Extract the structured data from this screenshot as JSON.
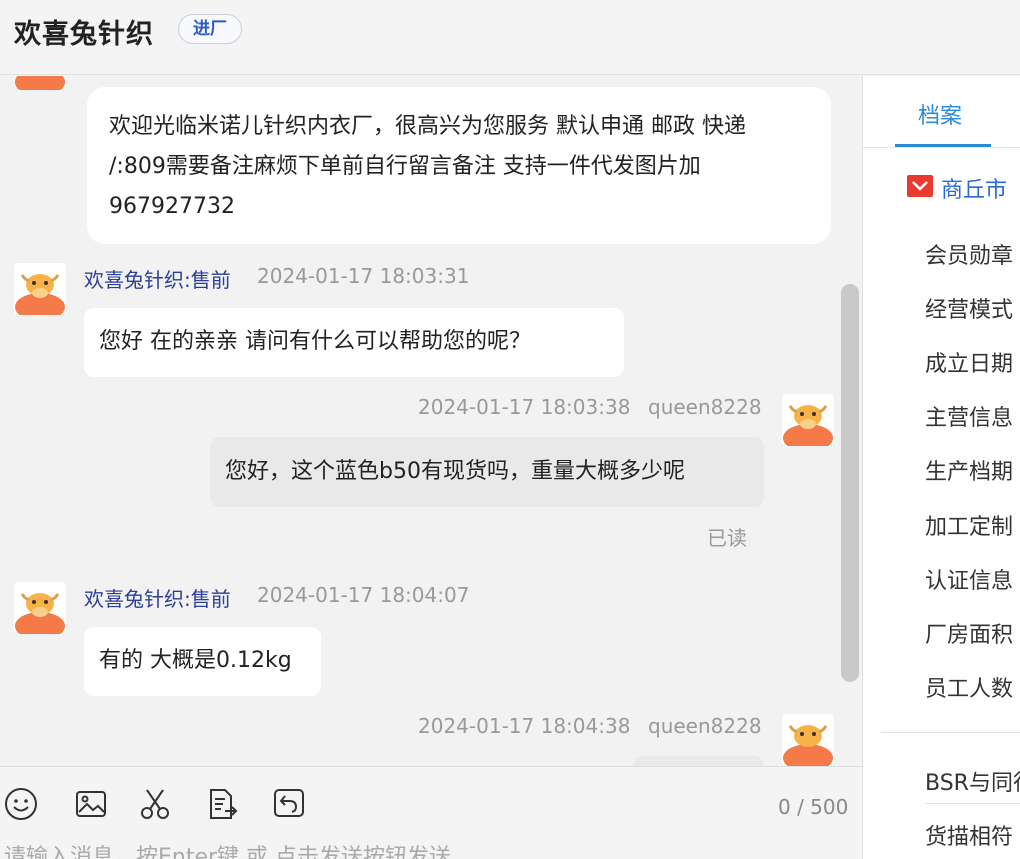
{
  "header": {
    "shop_name": "欢喜兔针织",
    "enter_tag": "进厂"
  },
  "messages": {
    "welcome": "欢迎光临米诺儿针织内衣厂，很高兴为您服务  默认申通 邮政 快递 /:809需要备注麻烦下单前自行留言备注   支持一件代发图片加 967927732",
    "m1": {
      "sender": "欢喜兔针织:售前",
      "time": "2024-01-17 18:03:31",
      "text": "您好  在的亲亲  请问有什么可以帮助您的呢？"
    },
    "m2": {
      "time": "2024-01-17 18:03:38",
      "user": "queen8228",
      "text": "您好，这个蓝色b50有现货吗，重量大概多少呢",
      "status": "已读"
    },
    "m3": {
      "sender": "欢喜兔针织:售前",
      "time": "2024-01-17 18:04:07",
      "text": "有的 大概是0.12kg"
    },
    "m4": {
      "time": "2024-01-17 18:04:38",
      "user": "queen8228"
    }
  },
  "input": {
    "counter": "0 / 500",
    "placeholder": "请输入消息，按Enter键 或 点击发送按钮发送",
    "tools": [
      "emoji-icon",
      "image-icon",
      "scissors-icon",
      "file-send-icon",
      "quick-reply-icon"
    ]
  },
  "panel": {
    "tab": "档案",
    "company": "商丘市",
    "items": [
      "会员勋章",
      "经营模式",
      "成立日期",
      "主营信息",
      "生产档期",
      "加工定制",
      "认证信息",
      "厂房面积",
      "员工人数"
    ],
    "bsr": "BSR与同行",
    "other": "货描相符"
  },
  "colors": {
    "link_blue": "#2a8ad8",
    "sender_blue": "#2b3f99",
    "avatar_orange": "#f47a4a"
  }
}
